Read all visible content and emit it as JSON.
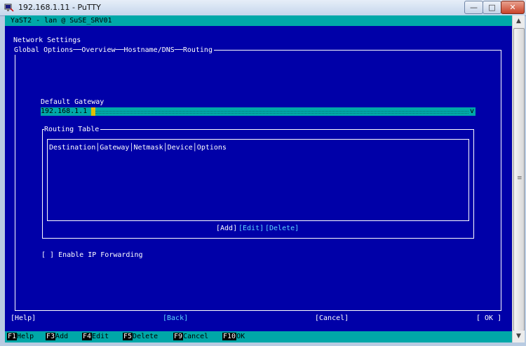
{
  "window": {
    "title": "192.168.1.11 - PuTTY",
    "minimize": "—",
    "maximize": "□",
    "close": "✕"
  },
  "terminal": {
    "top_bar": "YaST2 - lan @ SuSE_SRV01",
    "heading": "Network Settings",
    "breadcrumb": "Global Options──Overview──Hostname/DNS──Routing",
    "gateway": {
      "label": "Default Gateway",
      "value": "192.168.1.1",
      "dropdown": "v"
    },
    "routing_table": {
      "title": "Routing Table",
      "columns": [
        "Destination",
        "Gateway",
        "Netmask",
        "Device",
        "Options"
      ],
      "buttons": {
        "add": "[Add]",
        "edit": "[Edit]",
        "delete": "[Delete]"
      }
    },
    "ip_forwarding": "[ ] Enable IP Forwarding",
    "bottom_buttons": {
      "help": "[Help]",
      "back": "[Back]",
      "cancel": "[Cancel]",
      "ok": "[ OK ]"
    },
    "function_keys": [
      {
        "key": "F1",
        "label": "Help"
      },
      {
        "key": "F3",
        "label": "Add"
      },
      {
        "key": "F4",
        "label": "Edit"
      },
      {
        "key": "F5",
        "label": "Delete"
      },
      {
        "key": "F9",
        "label": "Cancel"
      },
      {
        "key": "F10",
        "label": "OK"
      }
    ]
  },
  "colors": {
    "background": "#0000a8",
    "accent": "#00a8a8",
    "highlight": "#5fd7ff"
  },
  "scrollbar": {
    "grip": "≡"
  }
}
